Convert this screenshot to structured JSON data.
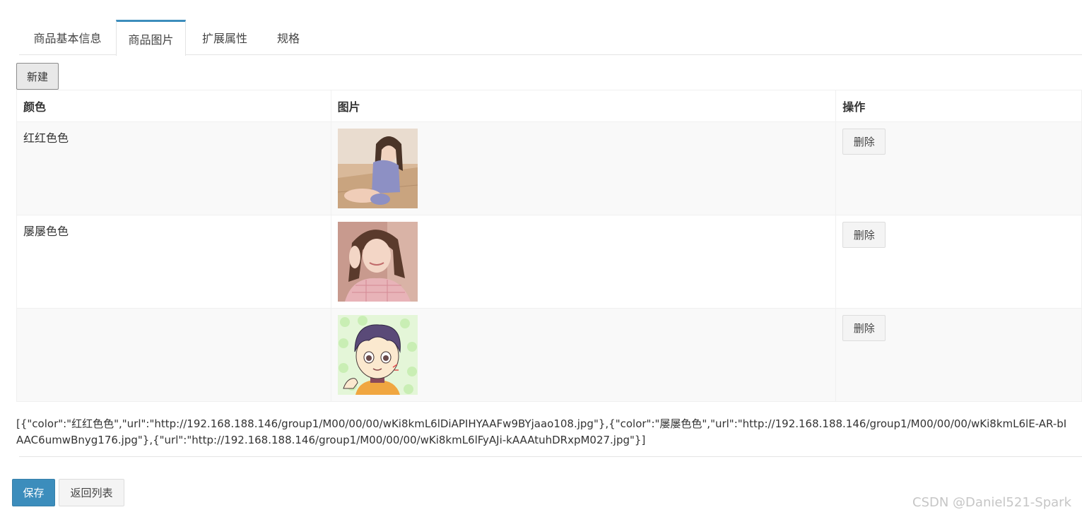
{
  "tabs": [
    {
      "label": "商品基本信息",
      "active": false
    },
    {
      "label": "商品图片",
      "active": true
    },
    {
      "label": "扩展属性",
      "active": false
    },
    {
      "label": "规格",
      "active": false
    }
  ],
  "toolbar": {
    "new_label": "新建"
  },
  "table": {
    "headers": [
      "颜色",
      "图片",
      "操作"
    ],
    "rows": [
      {
        "color": "红红色色",
        "image": "photo-girl-crouching",
        "action": "删除"
      },
      {
        "color": "屡屡色色",
        "image": "photo-girl-portrait",
        "action": "删除"
      },
      {
        "color": "",
        "image": "cartoon-child-avatar",
        "action": "删除"
      }
    ]
  },
  "json_dump": "[{\"color\":\"红红色色\",\"url\":\"http://192.168.188.146/group1/M00/00/00/wKi8kmL6lDiAPIHYAAFw9BYjaao108.jpg\"},{\"color\":\"屡屡色色\",\"url\":\"http://192.168.188.146/group1/M00/00/00/wKi8kmL6lE-AR-bIAAC6umwBnyg176.jpg\"},{\"url\":\"http://192.168.188.146/group1/M00/00/00/wKi8kmL6lFyAJi-kAAAtuhDRxpM027.jpg\"}]",
  "footer": {
    "save_label": "保存",
    "back_label": "返回列表"
  },
  "watermark": "CSDN @Daniel521-Spark",
  "colors": {
    "primary": "#3c8dbc",
    "tab_active_border": "#3c8dbc",
    "row_stripe": "#f9f9f9"
  }
}
